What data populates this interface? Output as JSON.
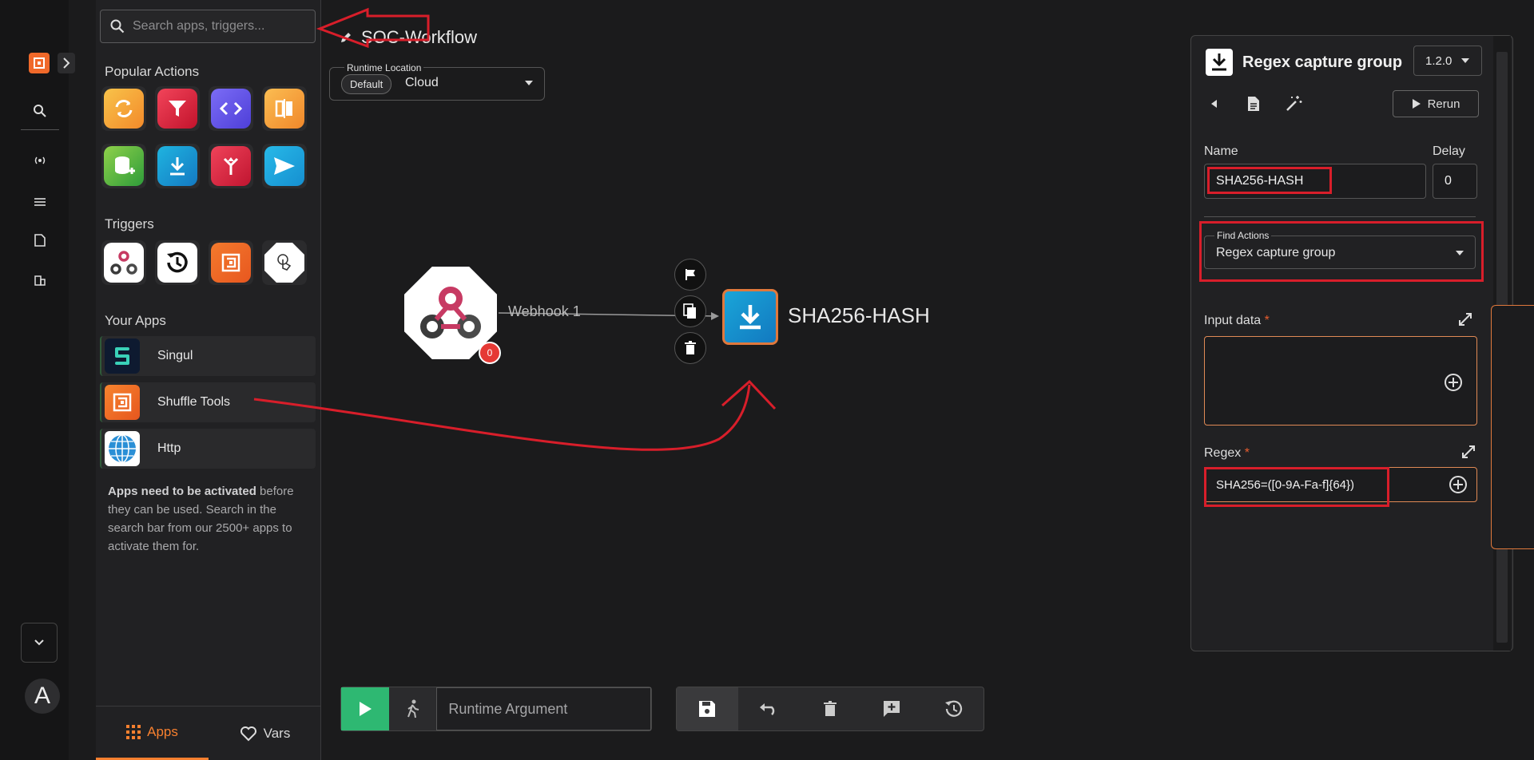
{
  "sidebar": {
    "search_placeholder": "Search apps, triggers...",
    "popular_title": "Popular Actions",
    "triggers_title": "Triggers",
    "your_apps_title": "Your Apps",
    "apps": [
      {
        "label": "Singul"
      },
      {
        "label": "Shuffle Tools"
      },
      {
        "label": "Http"
      }
    ],
    "notice_bold": "Apps need to be activated",
    "notice_rest": " before they can be used. Search in the search bar from our 2500+ apps to activate them for.",
    "tabs": {
      "apps": "Apps",
      "vars": "Vars"
    }
  },
  "rail": {
    "avatar_letter": "A"
  },
  "workflow": {
    "title": "SOC-Workflow",
    "runtime_label": "Runtime Location",
    "runtime_chip": "Default",
    "runtime_value": "Cloud",
    "webhook_badge": "0",
    "edge_label": "Webhook 1",
    "action_label": "SHA256-HASH"
  },
  "toolbar": {
    "runtime_placeholder": "Runtime Argument"
  },
  "panel": {
    "title": "Regex capture group",
    "version": "1.2.0",
    "rerun": "Rerun",
    "name_label": "Name",
    "name_value": "SHA256-HASH",
    "delay_label": "Delay",
    "delay_value": "0",
    "find_actions_label": "Find Actions",
    "find_actions_value": "Regex capture group",
    "input_data_label": "Input data",
    "regex_label": "Regex",
    "regex_value": "SHA256=([0-9A-Fa-f]{64})",
    "required_mark": "*"
  },
  "colors": {
    "accent": "#f7802f",
    "annotation_red": "#d81e2a",
    "run_green": "#2eb872"
  }
}
